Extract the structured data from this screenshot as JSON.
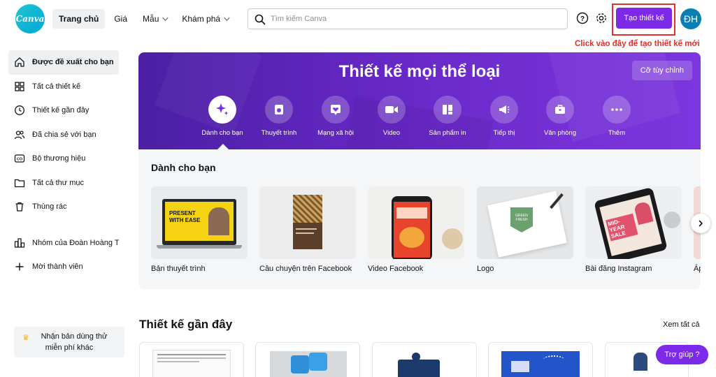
{
  "header": {
    "logo_text": "Canva",
    "nav": [
      {
        "label": "Trang chủ",
        "active": true,
        "dropdown": false
      },
      {
        "label": "Giá",
        "active": false,
        "dropdown": false
      },
      {
        "label": "Mẫu",
        "active": false,
        "dropdown": true
      },
      {
        "label": "Khám phá",
        "active": false,
        "dropdown": true
      }
    ],
    "search_placeholder": "Tìm kiếm Canva",
    "help_icon": "help-circle-icon",
    "settings_icon": "gear-icon",
    "create_label": "Tạo thiết kế",
    "avatar_initials": "ĐH",
    "annotation": "Click vào đây để tạo thiết kế mới"
  },
  "sidebar": {
    "items": [
      {
        "label": "Được đề xuất cho bạn",
        "icon": "home-icon",
        "active": true
      },
      {
        "label": "Tất cả thiết kế",
        "icon": "grid-icon",
        "active": false
      },
      {
        "label": "Thiết kế gần đây",
        "icon": "clock-icon",
        "active": false
      },
      {
        "label": "Đã chia sẻ với bạn",
        "icon": "people-icon",
        "active": false
      },
      {
        "label": "Bộ thương hiệu",
        "icon": "brand-kit-icon",
        "active": false
      },
      {
        "label": "Tất cả thư mục",
        "icon": "folder-icon",
        "active": false
      },
      {
        "label": "Thùng rác",
        "icon": "trash-icon",
        "active": false
      }
    ],
    "team": [
      {
        "label": "Nhóm của Đoàn Hoàng Th...",
        "icon": "team-icon"
      },
      {
        "label": "Mời thành viên",
        "icon": "plus-icon"
      }
    ],
    "trial_line1": "Nhận bản dùng thử",
    "trial_line2": "miễn phí khác",
    "trial_icon": "crown-icon"
  },
  "hero": {
    "title": "Thiết kế mọi thể loại",
    "custom_label": "Cỡ tùy chỉnh",
    "categories": [
      {
        "label": "Dành cho bạn",
        "icon": "sparkle-icon",
        "active": true
      },
      {
        "label": "Thuyết trình",
        "icon": "presentation-icon",
        "active": false
      },
      {
        "label": "Mạng xã hội",
        "icon": "heart-icon",
        "active": false
      },
      {
        "label": "Video",
        "icon": "video-icon",
        "active": false
      },
      {
        "label": "Sản phẩm in",
        "icon": "print-icon",
        "active": false
      },
      {
        "label": "Tiếp thị",
        "icon": "megaphone-icon",
        "active": false
      },
      {
        "label": "Văn phòng",
        "icon": "briefcase-icon",
        "active": false
      },
      {
        "label": "Thêm",
        "icon": "more-icon",
        "active": false
      }
    ]
  },
  "suggest": {
    "title": "Dành cho bạn",
    "cards": [
      {
        "label": "Bản thuyết trình",
        "thumb_text": "PRESENT WITH EASE"
      },
      {
        "label": "Câu chuyện trên Facebook",
        "thumb_text": ""
      },
      {
        "label": "Video Facebook",
        "thumb_text": ""
      },
      {
        "label": "Logo",
        "thumb_text": "GREEN FRESH"
      },
      {
        "label": "Bài đăng Instagram",
        "thumb_text": "MID-YEAR SALE"
      },
      {
        "label": "Áp",
        "thumb_text": ""
      }
    ]
  },
  "recent": {
    "title": "Thiết kế gần đây",
    "see_all": "Xem tất cả"
  },
  "help_label": "Trợ giúp ?",
  "colors": {
    "accent": "#7d2ae8",
    "annotation": "#e52d2d",
    "avatar": "#0b7fb3"
  }
}
